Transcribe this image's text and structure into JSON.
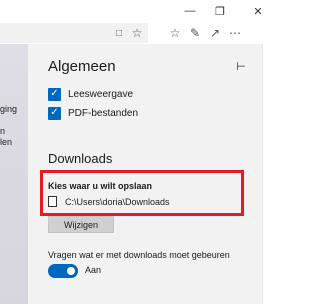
{
  "window": {
    "minimize_icon": "minimize-icon",
    "maximize_icon": "restore-icon",
    "close_icon": "close-icon"
  },
  "toolbar": {
    "icons": [
      "reading-view-icon",
      "favorite-star-icon",
      "favorites-hub-icon",
      "notes-pen-icon",
      "share-icon",
      "more-dots-icon"
    ]
  },
  "left_fragments": [
    "ging",
    "n",
    "len"
  ],
  "panel": {
    "title": "Algemeen",
    "pin_icon": "pin-icon",
    "checks": [
      {
        "label": "Leesweergave",
        "checked": true
      },
      {
        "label": "PDF-bestanden",
        "checked": true
      }
    ],
    "downloads_title": "Downloads",
    "location_label": "Kies waar u wilt opslaan",
    "location_path": "C:\\Users\\doria\\Downloads",
    "change_button": "Wijzigen",
    "ask_label": "Vragen wat er met downloads moet gebeuren",
    "toggle_state": "Aan",
    "toggle_on": true
  },
  "colors": {
    "accent": "#0067c0",
    "highlight": "#e21b24",
    "panel_bg": "#f2f2f2"
  }
}
